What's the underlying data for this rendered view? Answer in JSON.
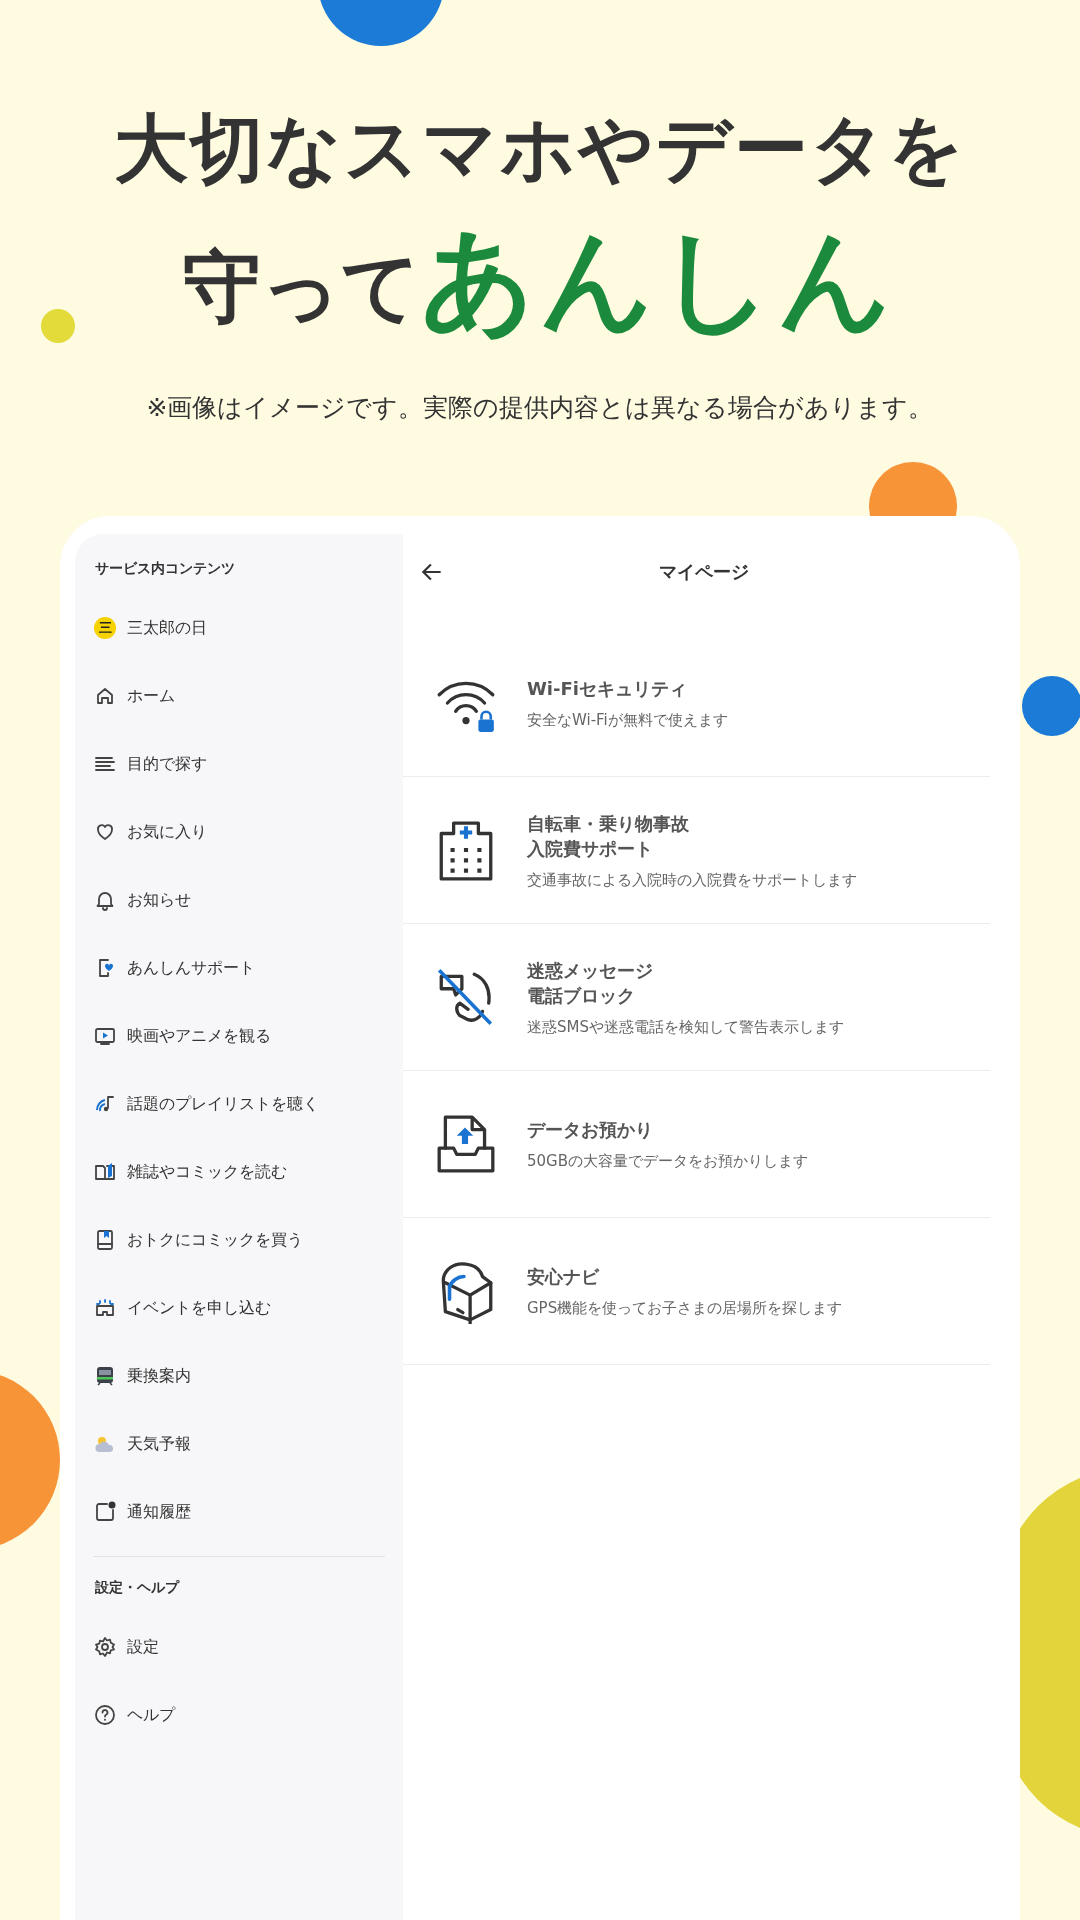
{
  "headline": {
    "line_1": "大切なスマホやデータを",
    "line_2": [
      {
        "text": "守って",
        "kind": "plain"
      },
      {
        "text": "あんしん",
        "kind": "accent"
      }
    ]
  },
  "note": "※画像はイメージです。実際の提供内容とは異なる場合があります。",
  "sidebar": {
    "sections": [
      {
        "heading": "サービス内コンテンツ",
        "items": [
          {
            "label": "三太郎の日",
            "kind": "badge",
            "badge": "三"
          },
          {
            "label": "ホーム",
            "kind": "home"
          },
          {
            "label": "目的で探す",
            "kind": "lines"
          },
          {
            "label": "お気に入り",
            "kind": "heart"
          },
          {
            "label": "お知らせ",
            "kind": "bell"
          },
          {
            "label": "あんしんサポート",
            "kind": "support"
          },
          {
            "label": "映画やアニメを観る",
            "kind": "play"
          },
          {
            "label": "話題のプレイリストを聴く",
            "kind": "music"
          },
          {
            "label": "雑誌やコミックを読む",
            "kind": "book"
          },
          {
            "label": "おトクにコミックを買う",
            "kind": "comic"
          },
          {
            "label": "イベントを申し込む",
            "kind": "event"
          },
          {
            "label": "乗換案内",
            "kind": "train"
          },
          {
            "label": "天気予報",
            "kind": "weather"
          },
          {
            "label": "通知履歴",
            "kind": "notify"
          }
        ]
      },
      {
        "heading": "設定・ヘルプ",
        "items": [
          {
            "label": "設定",
            "kind": "gear"
          },
          {
            "label": "ヘルプ",
            "kind": "help"
          }
        ]
      }
    ]
  },
  "mypage": {
    "title": "マイページ",
    "items": [
      {
        "title_lines": [
          "Wi-Fiセキュリティ"
        ],
        "subtitle": "安全なWi-Fiが無料で使えます",
        "kind": "wifi"
      },
      {
        "title_lines": [
          "自転車・乗り物事故",
          "入院費サポート"
        ],
        "subtitle": "交通事故による入院時の入院費をサポートします",
        "kind": "hospital"
      },
      {
        "title_lines": [
          "迷惑メッセージ",
          "電話ブロック"
        ],
        "subtitle": "迷惑SMSや迷惑電話を検知して警告表示します",
        "kind": "block"
      },
      {
        "title_lines": [
          "データお預かり"
        ],
        "subtitle": "50GBの大容量でデータをお預かりします",
        "kind": "upload"
      },
      {
        "title_lines": [
          "安心ナビ"
        ],
        "subtitle": "GPS機能を使ってお子さまの居場所を探します",
        "kind": "backpack"
      }
    ]
  }
}
